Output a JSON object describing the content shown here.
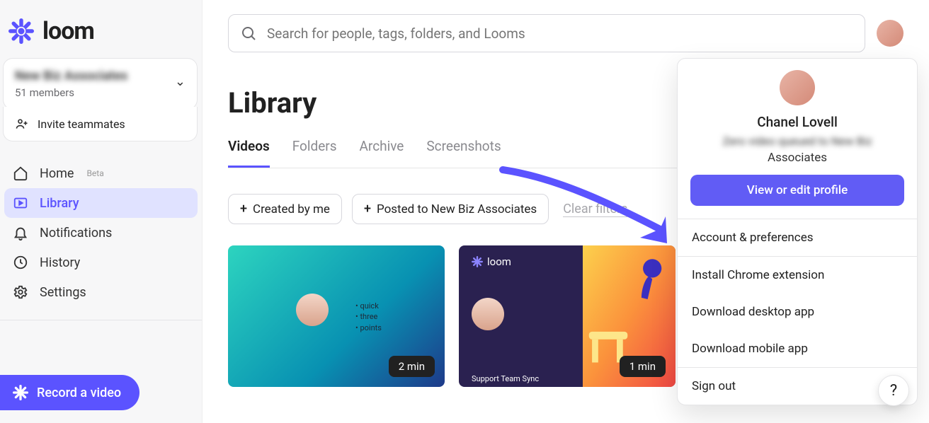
{
  "brand": {
    "name": "loom"
  },
  "workspace": {
    "name": "New Biz Associates",
    "members": "51 members",
    "invite": "Invite teammates"
  },
  "sidebar": {
    "items": [
      {
        "label": "Home",
        "badge": "Beta",
        "icon": "home"
      },
      {
        "label": "Library",
        "icon": "library",
        "active": true
      },
      {
        "label": "Notifications",
        "icon": "bell"
      },
      {
        "label": "History",
        "icon": "clock"
      },
      {
        "label": "Settings",
        "icon": "gear"
      }
    ],
    "record": "Record a video"
  },
  "search": {
    "placeholder": "Search for people, tags, folders, and Looms"
  },
  "page": {
    "title": "Library"
  },
  "tabs": [
    "Videos",
    "Folders",
    "Archive",
    "Screenshots"
  ],
  "active_tab": 0,
  "filters": {
    "chips": [
      "Created by me",
      "Posted to New Biz Associates"
    ],
    "clear": "Clear filters"
  },
  "cards": [
    {
      "duration": "2 min",
      "bullets": [
        "• quick",
        "• three",
        "• points"
      ]
    },
    {
      "duration": "1 min",
      "mini_brand": "loom",
      "caption": "Support Team Sync"
    }
  ],
  "profile_menu": {
    "name": "Chanel Lovell",
    "line2": "Zero video queued to New Biz",
    "line3": "Associates",
    "cta": "View or edit profile",
    "items_a": [
      "Account & preferences"
    ],
    "items_b": [
      "Install Chrome extension",
      "Download desktop app",
      "Download mobile app"
    ],
    "items_c": [
      "Sign out"
    ]
  },
  "help": "?"
}
